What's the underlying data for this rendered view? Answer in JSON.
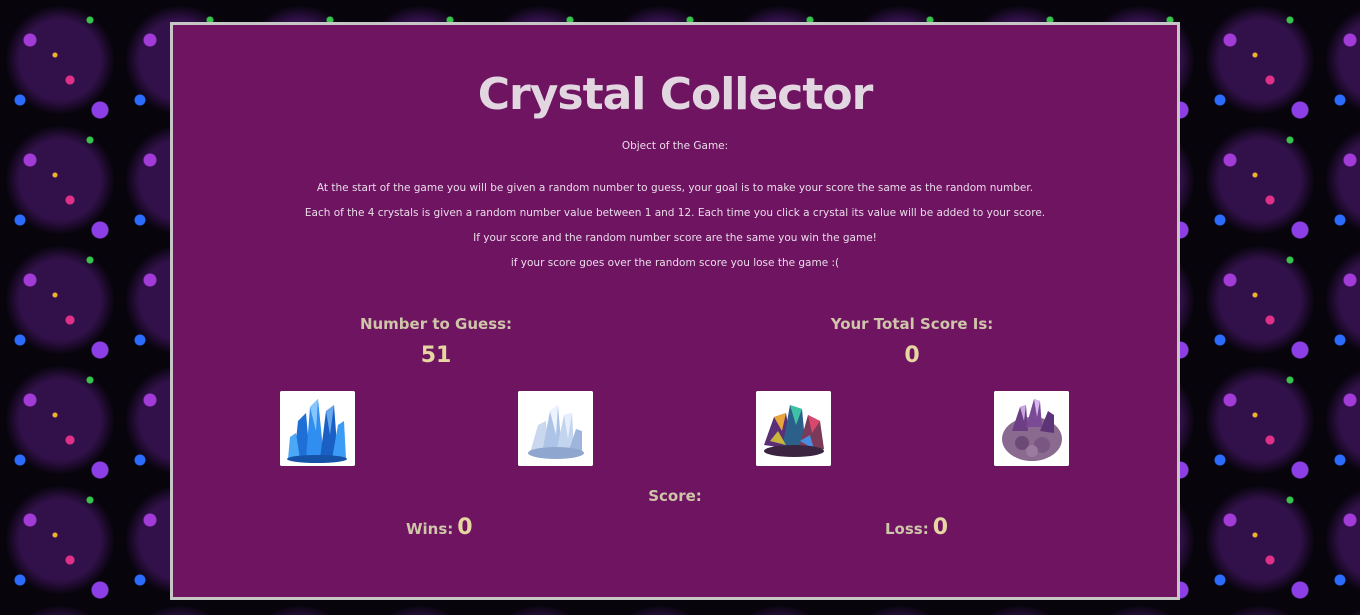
{
  "game": {
    "title": "Crystal Collector",
    "objective_heading": "Object of the Game:",
    "rules": [
      "At the start of the game you will be given a random number to guess, your goal is to make your score the same as the random number.",
      "Each of the 4 crystals is given a random number value between 1 and 12. Each time you click a crystal its value will be added to your score.",
      "If your score and the random number score are the same you win the game!",
      "if your score goes over the random score you lose the game :("
    ]
  },
  "target": {
    "label": "Number to Guess:",
    "value": "51"
  },
  "total": {
    "label": "Your Total Score Is:",
    "value": "0"
  },
  "crystals": [
    {
      "icon": "blue-crystal-icon",
      "color": "#2d7de0"
    },
    {
      "icon": "clear-quartz-crystal-icon",
      "color": "#b9cbe6"
    },
    {
      "icon": "rainbow-titanium-crystal-icon",
      "color": "#7a3f8e"
    },
    {
      "icon": "amethyst-crystal-icon",
      "color": "#7a4e83"
    }
  ],
  "score": {
    "heading": "Score:",
    "wins_label": "Wins:",
    "wins": "0",
    "loss_label": "Loss:",
    "loss": "0"
  },
  "colors": {
    "panel": "#6e1461",
    "border": "#c6c6c6",
    "accent_number": "#e6d6a2"
  }
}
